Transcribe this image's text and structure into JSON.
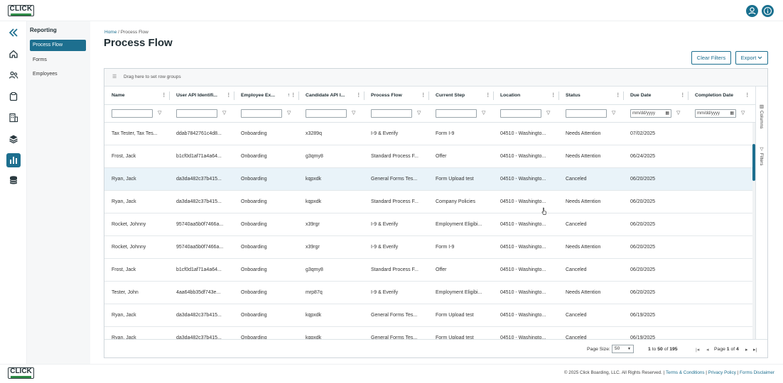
{
  "brand": {
    "logo_text": "CLICK",
    "logo_sub": "BOARDING"
  },
  "topbar": {
    "account_icon": "user-circle-icon",
    "info_icon": "info-circle-icon"
  },
  "nav_rail": {
    "items": [
      {
        "icon": "collapse-chevrons-icon"
      },
      {
        "icon": "home-icon"
      },
      {
        "icon": "people-icon"
      },
      {
        "icon": "clipboard-icon"
      },
      {
        "icon": "building-icon"
      },
      {
        "icon": "layers-icon"
      },
      {
        "icon": "bar-chart-icon",
        "active": true
      },
      {
        "icon": "database-icon"
      }
    ]
  },
  "submenu": {
    "heading": "Reporting",
    "items": [
      {
        "label": "Process Flow",
        "active": true
      },
      {
        "label": "Forms"
      },
      {
        "label": "Employees"
      }
    ]
  },
  "breadcrumb": {
    "home": "Home",
    "separator": "/",
    "current": "Process Flow"
  },
  "page_title": "Process Flow",
  "toolbar": {
    "clear_filters": "Clear Filters",
    "export": "Export"
  },
  "grid": {
    "group_panel": "Drag here to set row groups",
    "columns": [
      "Name",
      "User API Identifi...",
      "Employee Ex...",
      "Candidate API I...",
      "Process Flow",
      "Current Step",
      "Location",
      "Status",
      "Due Date",
      "Completion Date"
    ],
    "date_placeholder": "mm/dd/yyyy",
    "rows": [
      [
        "Tax Tester, Tax Tes...",
        "ddab7842761c4d8...",
        "Onboarding",
        "x3289q",
        "I-9 & Everify",
        "Form I-9",
        "04510 - Washingto...",
        "Needs Attention",
        "07/02/2025",
        ""
      ],
      [
        "Frost, Jack",
        "b1cf0d1af71a4a64...",
        "Onboarding",
        "g3qmy8",
        "Standard Process F...",
        "Offer",
        "04510 - Washingto...",
        "Needs Attention",
        "06/24/2025",
        ""
      ],
      [
        "Ryan, Jack",
        "da3da482c37b415...",
        "Onboarding",
        "kqpxdk",
        "General Forms Tes...",
        "Form Upload test",
        "04510 - Washingto...",
        "Canceled",
        "06/20/2025",
        ""
      ],
      [
        "Ryan, Jack",
        "da3da482c37b415...",
        "Onboarding",
        "kqpxdk",
        "Standard Process F...",
        "Company Policies",
        "04510 - Washingto...",
        "Needs Attention",
        "06/20/2025",
        ""
      ],
      [
        "Rocket, Johnny",
        "95740aa5b0f7466a...",
        "Onboarding",
        "x39rgr",
        "I-9 & Everify",
        "Employment Eligibi...",
        "04510 - Washingto...",
        "Canceled",
        "06/20/2025",
        ""
      ],
      [
        "Rocket, Johnny",
        "95740aa5b0f7466a...",
        "Onboarding",
        "x39rgr",
        "I-9 & Everify",
        "Form I-9",
        "04510 - Washingto...",
        "Needs Attention",
        "06/20/2025",
        ""
      ],
      [
        "Frost, Jack",
        "b1cf0d1af71a4a64...",
        "Onboarding",
        "g3qmy8",
        "Standard Process F...",
        "Offer",
        "04510 - Washingto...",
        "Canceled",
        "06/20/2025",
        ""
      ],
      [
        "Tester, John",
        "4aa64bb35df743e...",
        "Onboarding",
        "mrp87q",
        "I-9 & Everify",
        "Employment Eligibi...",
        "04510 - Washingto...",
        "Needs Attention",
        "06/20/2025",
        ""
      ],
      [
        "Ryan, Jack",
        "da3da482c37b415...",
        "Onboarding",
        "kqpxdk",
        "General Forms Tes...",
        "Form Upload test",
        "04510 - Washingto...",
        "Canceled",
        "06/19/2025",
        ""
      ],
      [
        "Ryan, Jack",
        "da3da482c37b415...",
        "Onboarding",
        "kqpxdk",
        "General Forms Tes...",
        "Form Upload test",
        "04510 - Washingto...",
        "Canceled",
        "06/19/2025",
        ""
      ]
    ],
    "selected_row": 2,
    "side_tabs": {
      "columns": "Columns",
      "filters": "Filters"
    }
  },
  "pager": {
    "page_size_label": "Page Size:",
    "page_size": "50",
    "range_from": "1",
    "range_to_word": "to",
    "range_to": "50",
    "of_word": "of",
    "total": "195",
    "page_word": "Page",
    "page": "1",
    "page_of": "4"
  },
  "footer": {
    "copyright": "© 2025 Click Boarding, LLC. All Rights Reserved.",
    "sep": "|",
    "terms": "Terms & Conditions",
    "privacy": "Privacy Policy",
    "disclaimer": "Forms Disclaimer"
  },
  "colors": {
    "accent": "#1d6f8f",
    "selected_row": "#e9f3f9"
  }
}
